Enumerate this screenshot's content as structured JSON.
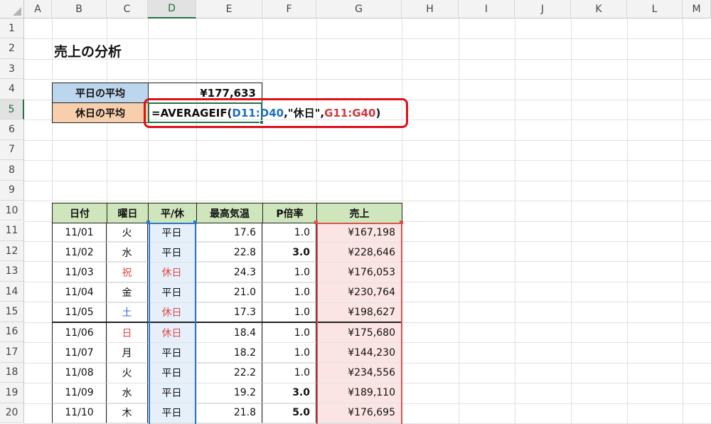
{
  "columns": [
    "A",
    "B",
    "C",
    "D",
    "E",
    "F",
    "G",
    "H",
    "I",
    "J",
    "K",
    "L",
    "M"
  ],
  "rows": [
    "1",
    "2",
    "3",
    "4",
    "5",
    "6",
    "7",
    "8",
    "9",
    "10",
    "11",
    "12",
    "13",
    "14",
    "15",
    "16",
    "17",
    "18",
    "19",
    "20"
  ],
  "title": "売上の分析",
  "summary": {
    "weekday_label": "平日の平均",
    "weekday_value": "¥177,633",
    "holiday_label": "休日の平均"
  },
  "formula": {
    "prefix": "=AVERAGEIF(",
    "range": "D11:D40",
    "criteria": ",\"休日\",",
    "avg_range": "G11:G40",
    "suffix": ")"
  },
  "table": {
    "headers": [
      "日付",
      "曜日",
      "平/休",
      "最高気温",
      "P倍率",
      "売上"
    ],
    "rows": [
      {
        "date": "11/01",
        "dow": "火",
        "type": "平日",
        "temp": "17.6",
        "rate": "1.0",
        "sales": "¥167,198"
      },
      {
        "date": "11/02",
        "dow": "水",
        "type": "平日",
        "temp": "22.8",
        "rate": "3.0",
        "sales": "¥228,646"
      },
      {
        "date": "11/03",
        "dow": "祝",
        "type": "休日",
        "temp": "24.3",
        "rate": "1.0",
        "sales": "¥176,053"
      },
      {
        "date": "11/04",
        "dow": "金",
        "type": "平日",
        "temp": "21.0",
        "rate": "1.0",
        "sales": "¥230,764"
      },
      {
        "date": "11/05",
        "dow": "土",
        "type": "休日",
        "temp": "17.3",
        "rate": "1.0",
        "sales": "¥198,627"
      },
      {
        "date": "11/06",
        "dow": "日",
        "type": "休日",
        "temp": "18.4",
        "rate": "1.0",
        "sales": "¥175,680"
      },
      {
        "date": "11/07",
        "dow": "月",
        "type": "平日",
        "temp": "18.2",
        "rate": "1.0",
        "sales": "¥144,230"
      },
      {
        "date": "11/08",
        "dow": "火",
        "type": "平日",
        "temp": "22.2",
        "rate": "1.0",
        "sales": "¥234,556"
      },
      {
        "date": "11/09",
        "dow": "水",
        "type": "平日",
        "temp": "19.2",
        "rate": "3.0",
        "sales": "¥189,110"
      },
      {
        "date": "11/10",
        "dow": "木",
        "type": "平日",
        "temp": "21.8",
        "rate": "5.0",
        "sales": "¥176,695"
      }
    ]
  },
  "colors": {
    "header_green": "#cfe6bc",
    "weekday_blue": "#bcd6ee",
    "holiday_orange": "#f7cfac",
    "holiday_text_red": "#e24646",
    "saturday_blue": "#2f76c6",
    "highlight_red": "#e0101a",
    "selection_green": "#217346"
  }
}
